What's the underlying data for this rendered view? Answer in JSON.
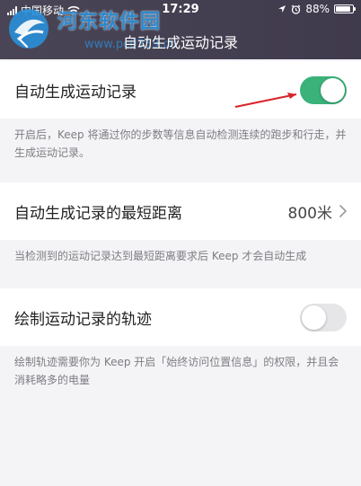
{
  "status_bar": {
    "carrier": "中国移动",
    "time": "17:29",
    "battery": "88%",
    "battery_level": 0.88
  },
  "watermark": {
    "site_name": "河东软件园",
    "url": "www.pc0359.cn"
  },
  "header": {
    "title": "自动生成运动记录"
  },
  "settings": {
    "auto_record": {
      "label": "自动生成运动记录",
      "enabled": true,
      "description": "开启后，Keep 将通过你的步数等信息自动检测连续的跑步和行走，并生成运动记录。"
    },
    "min_distance": {
      "label": "自动生成记录的最短距离",
      "value": "800米",
      "description": "当检测到的运动记录达到最短距离要求后 Keep 才会自动生成"
    },
    "track": {
      "label": "绘制运动记录的轨迹",
      "enabled": false,
      "description": "绘制轨迹需要你为 Keep 开启「始终访问位置信息」的权限，并且会消耗略多的电量"
    }
  },
  "colors": {
    "header_bg": "#45404f",
    "toggle_on": "#3ab27a",
    "toggle_off": "#e6e6e8",
    "page_bg": "#f4f4f6",
    "annotation_arrow": "#d9232a"
  }
}
